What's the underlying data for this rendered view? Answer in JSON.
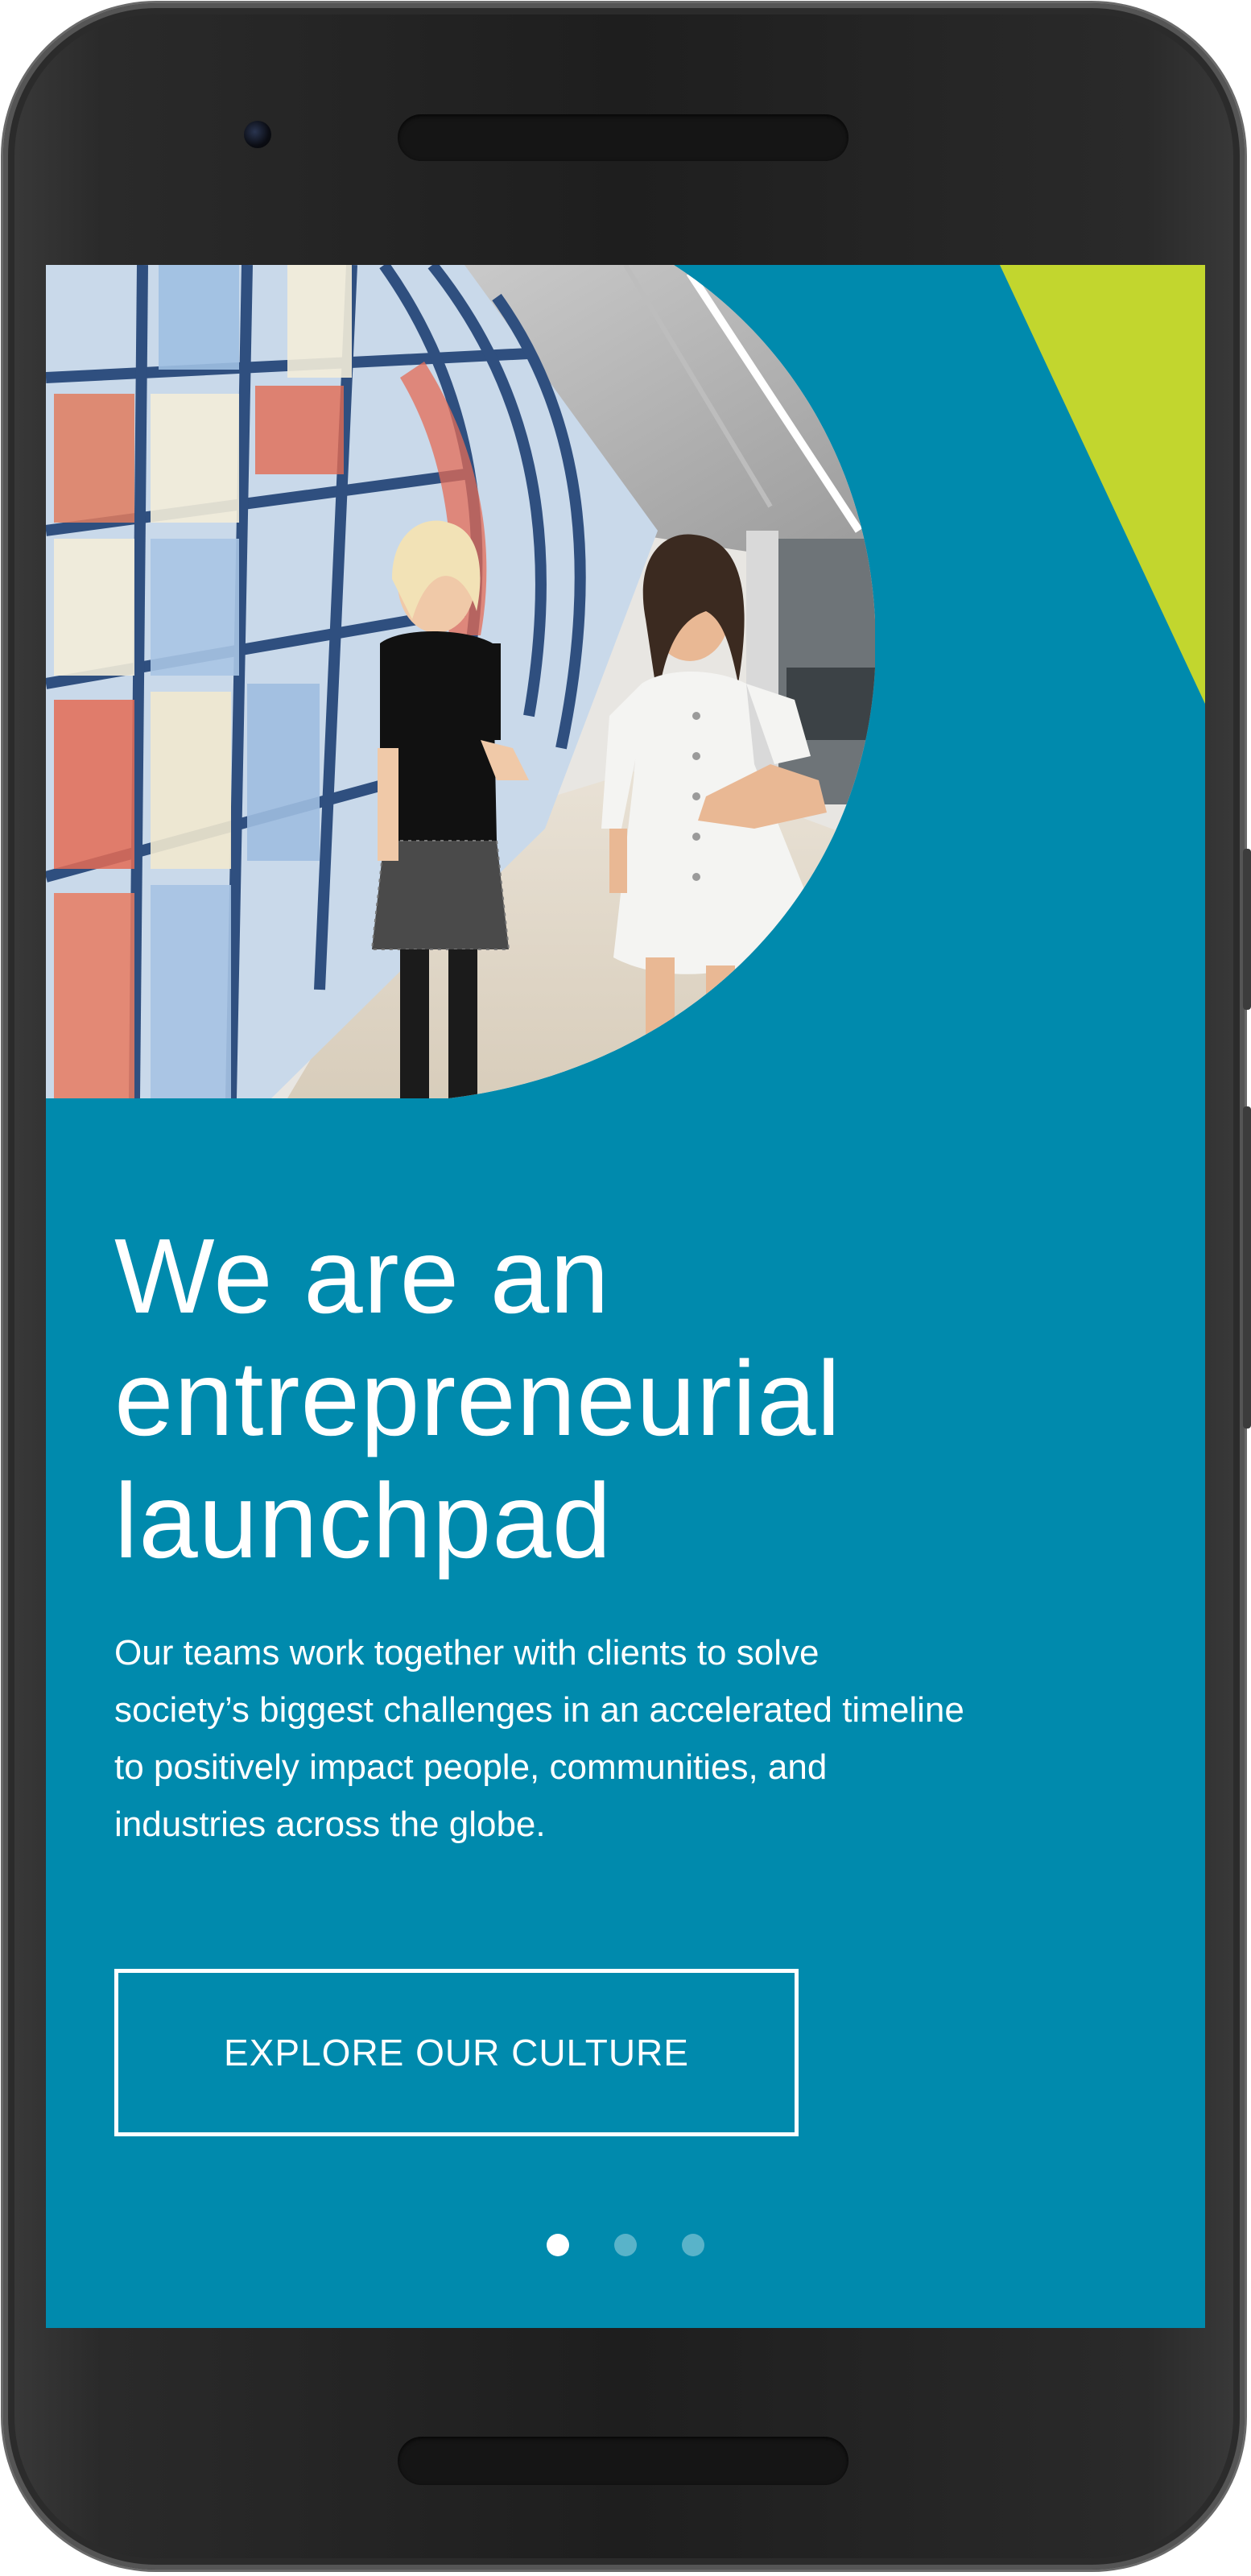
{
  "theme": {
    "screen_bg": "#008aad",
    "accent_green": "#c2d62e",
    "text_color": "#ffffff"
  },
  "hero": {
    "image_description_icon": "photo-two-women-walking-office"
  },
  "content": {
    "headline_line1": "We are an",
    "headline_line2": "entrepreneurial",
    "headline_line3": "launchpad",
    "body_line1": "Our teams work together with clients to solve",
    "body_line2": "society’s biggest challenges in an accelerated timeline",
    "body_line3": "to positively impact people, communities, and",
    "body_line4": "industries across the globe.",
    "cta_label": "EXPLORE OUR CULTURE"
  },
  "carousel": {
    "slide_count": 3,
    "active_index": 0
  }
}
